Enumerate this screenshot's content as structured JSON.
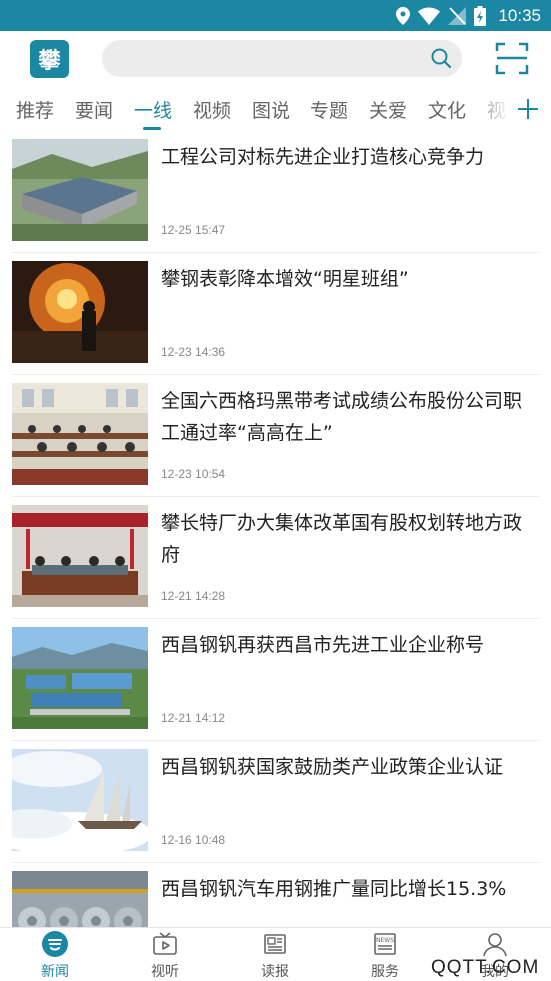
{
  "status_bar": {
    "time": "10:35"
  },
  "header": {
    "logo_text": "攀"
  },
  "colors": {
    "accent": "#1c87a3",
    "status_bar": "#1c87a3",
    "search_bg": "#ececec"
  },
  "tabs": [
    {
      "label": "推荐",
      "active": false
    },
    {
      "label": "要闻",
      "active": false
    },
    {
      "label": "一线",
      "active": true
    },
    {
      "label": "视频",
      "active": false
    },
    {
      "label": "图说",
      "active": false
    },
    {
      "label": "专题",
      "active": false
    },
    {
      "label": "关爱",
      "active": false
    },
    {
      "label": "文化",
      "active": false
    },
    {
      "label": "视",
      "active": false
    }
  ],
  "news": [
    {
      "title": "工程公司对标先进企业打造核心竞争力",
      "time": "12-25 15:47"
    },
    {
      "title": "攀钢表彰降本增效“明星班组”",
      "time": "12-23 14:36"
    },
    {
      "title": "全国六西格玛黑带考试成绩公布股份公司职工通过率“高高在上”",
      "time": "12-23 10:54"
    },
    {
      "title": "攀长特厂办大集体改革国有股权划转地方政府",
      "time": "12-21 14:28"
    },
    {
      "title": "西昌钢钒再获西昌市先进工业企业称号",
      "time": "12-21 14:12"
    },
    {
      "title": "西昌钢钒获国家鼓励类产业政策企业认证",
      "time": "12-16 10:48"
    },
    {
      "title": "西昌钢钒汽车用钢推广量同比增长15.3%",
      "time": ""
    }
  ],
  "bottom_nav": [
    {
      "label": "新闻",
      "icon": "news-logo-icon",
      "active": true
    },
    {
      "label": "视听",
      "icon": "tv-play-icon",
      "active": false
    },
    {
      "label": "读报",
      "icon": "newspaper-icon",
      "active": false
    },
    {
      "label": "服务",
      "icon": "news-service-icon",
      "active": false
    },
    {
      "label": "我的",
      "icon": "user-icon",
      "active": false
    }
  ],
  "watermark": "QQTT.COM"
}
